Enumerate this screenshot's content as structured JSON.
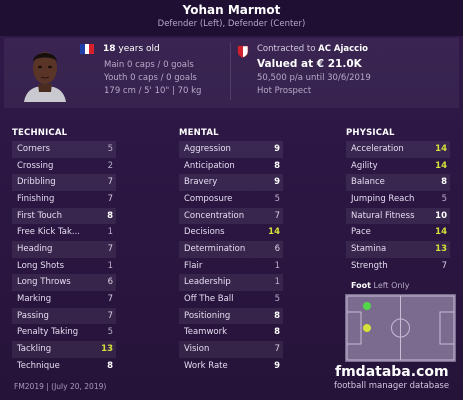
{
  "header": {
    "name": "Yohan Marmot",
    "positions": "Defender (Left), Defender (Center)"
  },
  "profile": {
    "age_number": "18",
    "age_text": " years old",
    "main_caps": "Main 0 caps / 0 goals",
    "youth_caps": "Youth 0 caps / 0 goals",
    "size": "179 cm / 5' 10\" | 70 kg",
    "contract_prefix": "Contracted to ",
    "club": "AC Ajaccio",
    "value": "Valued at € 21.0K",
    "wage": "50,500 p/a until 30/6/2019",
    "status": "Hot Prospect",
    "flag_colors": [
      "#1f3ea8",
      "#ffffff",
      "#d81f2a"
    ],
    "badge_colors": [
      "#d0212e",
      "#ffffff"
    ]
  },
  "sections": {
    "technical": "TECHNICAL",
    "mental": "MENTAL",
    "physical": "PHYSICAL"
  },
  "technical": [
    {
      "name": "Corners",
      "value": "5",
      "color": "#b9aec8"
    },
    {
      "name": "Crossing",
      "value": "2",
      "color": "#b9aec8"
    },
    {
      "name": "Dribbling",
      "value": "7",
      "color": "#dcd3e8"
    },
    {
      "name": "Finishing",
      "value": "7",
      "color": "#dcd3e8"
    },
    {
      "name": "First Touch",
      "value": "8",
      "color": "#ffffff"
    },
    {
      "name": "Free Kick Tak...",
      "value": "1",
      "color": "#b9aec8"
    },
    {
      "name": "Heading",
      "value": "7",
      "color": "#dcd3e8"
    },
    {
      "name": "Long Shots",
      "value": "1",
      "color": "#b9aec8"
    },
    {
      "name": "Long Throws",
      "value": "6",
      "color": "#dcd3e8"
    },
    {
      "name": "Marking",
      "value": "7",
      "color": "#dcd3e8"
    },
    {
      "name": "Passing",
      "value": "7",
      "color": "#dcd3e8"
    },
    {
      "name": "Penalty Taking",
      "value": "5",
      "color": "#b9aec8"
    },
    {
      "name": "Tackling",
      "value": "13",
      "color": "#d6e03a"
    },
    {
      "name": "Technique",
      "value": "8",
      "color": "#ffffff"
    }
  ],
  "mental": [
    {
      "name": "Aggression",
      "value": "9",
      "color": "#ffffff"
    },
    {
      "name": "Anticipation",
      "value": "8",
      "color": "#ffffff"
    },
    {
      "name": "Bravery",
      "value": "9",
      "color": "#ffffff"
    },
    {
      "name": "Composure",
      "value": "5",
      "color": "#b9aec8"
    },
    {
      "name": "Concentration",
      "value": "7",
      "color": "#dcd3e8"
    },
    {
      "name": "Decisions",
      "value": "14",
      "color": "#d6e03a"
    },
    {
      "name": "Determination",
      "value": "6",
      "color": "#dcd3e8"
    },
    {
      "name": "Flair",
      "value": "1",
      "color": "#b9aec8"
    },
    {
      "name": "Leadership",
      "value": "1",
      "color": "#b9aec8"
    },
    {
      "name": "Off The Ball",
      "value": "5",
      "color": "#b9aec8"
    },
    {
      "name": "Positioning",
      "value": "8",
      "color": "#ffffff"
    },
    {
      "name": "Teamwork",
      "value": "8",
      "color": "#ffffff"
    },
    {
      "name": "Vision",
      "value": "7",
      "color": "#dcd3e8"
    },
    {
      "name": "Work Rate",
      "value": "9",
      "color": "#ffffff"
    }
  ],
  "physical": [
    {
      "name": "Acceleration",
      "value": "14",
      "color": "#d6e03a"
    },
    {
      "name": "Agility",
      "value": "14",
      "color": "#d6e03a"
    },
    {
      "name": "Balance",
      "value": "8",
      "color": "#ffffff"
    },
    {
      "name": "Jumping Reach",
      "value": "5",
      "color": "#b9aec8"
    },
    {
      "name": "Natural Fitness",
      "value": "10",
      "color": "#ffffff"
    },
    {
      "name": "Pace",
      "value": "14",
      "color": "#d6e03a"
    },
    {
      "name": "Stamina",
      "value": "13",
      "color": "#d6e03a"
    },
    {
      "name": "Strength",
      "value": "7",
      "color": "#dcd3e8"
    }
  ],
  "foot": {
    "label": "Foot",
    "value": " Left Only"
  },
  "footer": {
    "version": "FM2019 | (July 20, 2019)",
    "brand": "fmdataba.com",
    "brand_sub": "football manager database"
  }
}
